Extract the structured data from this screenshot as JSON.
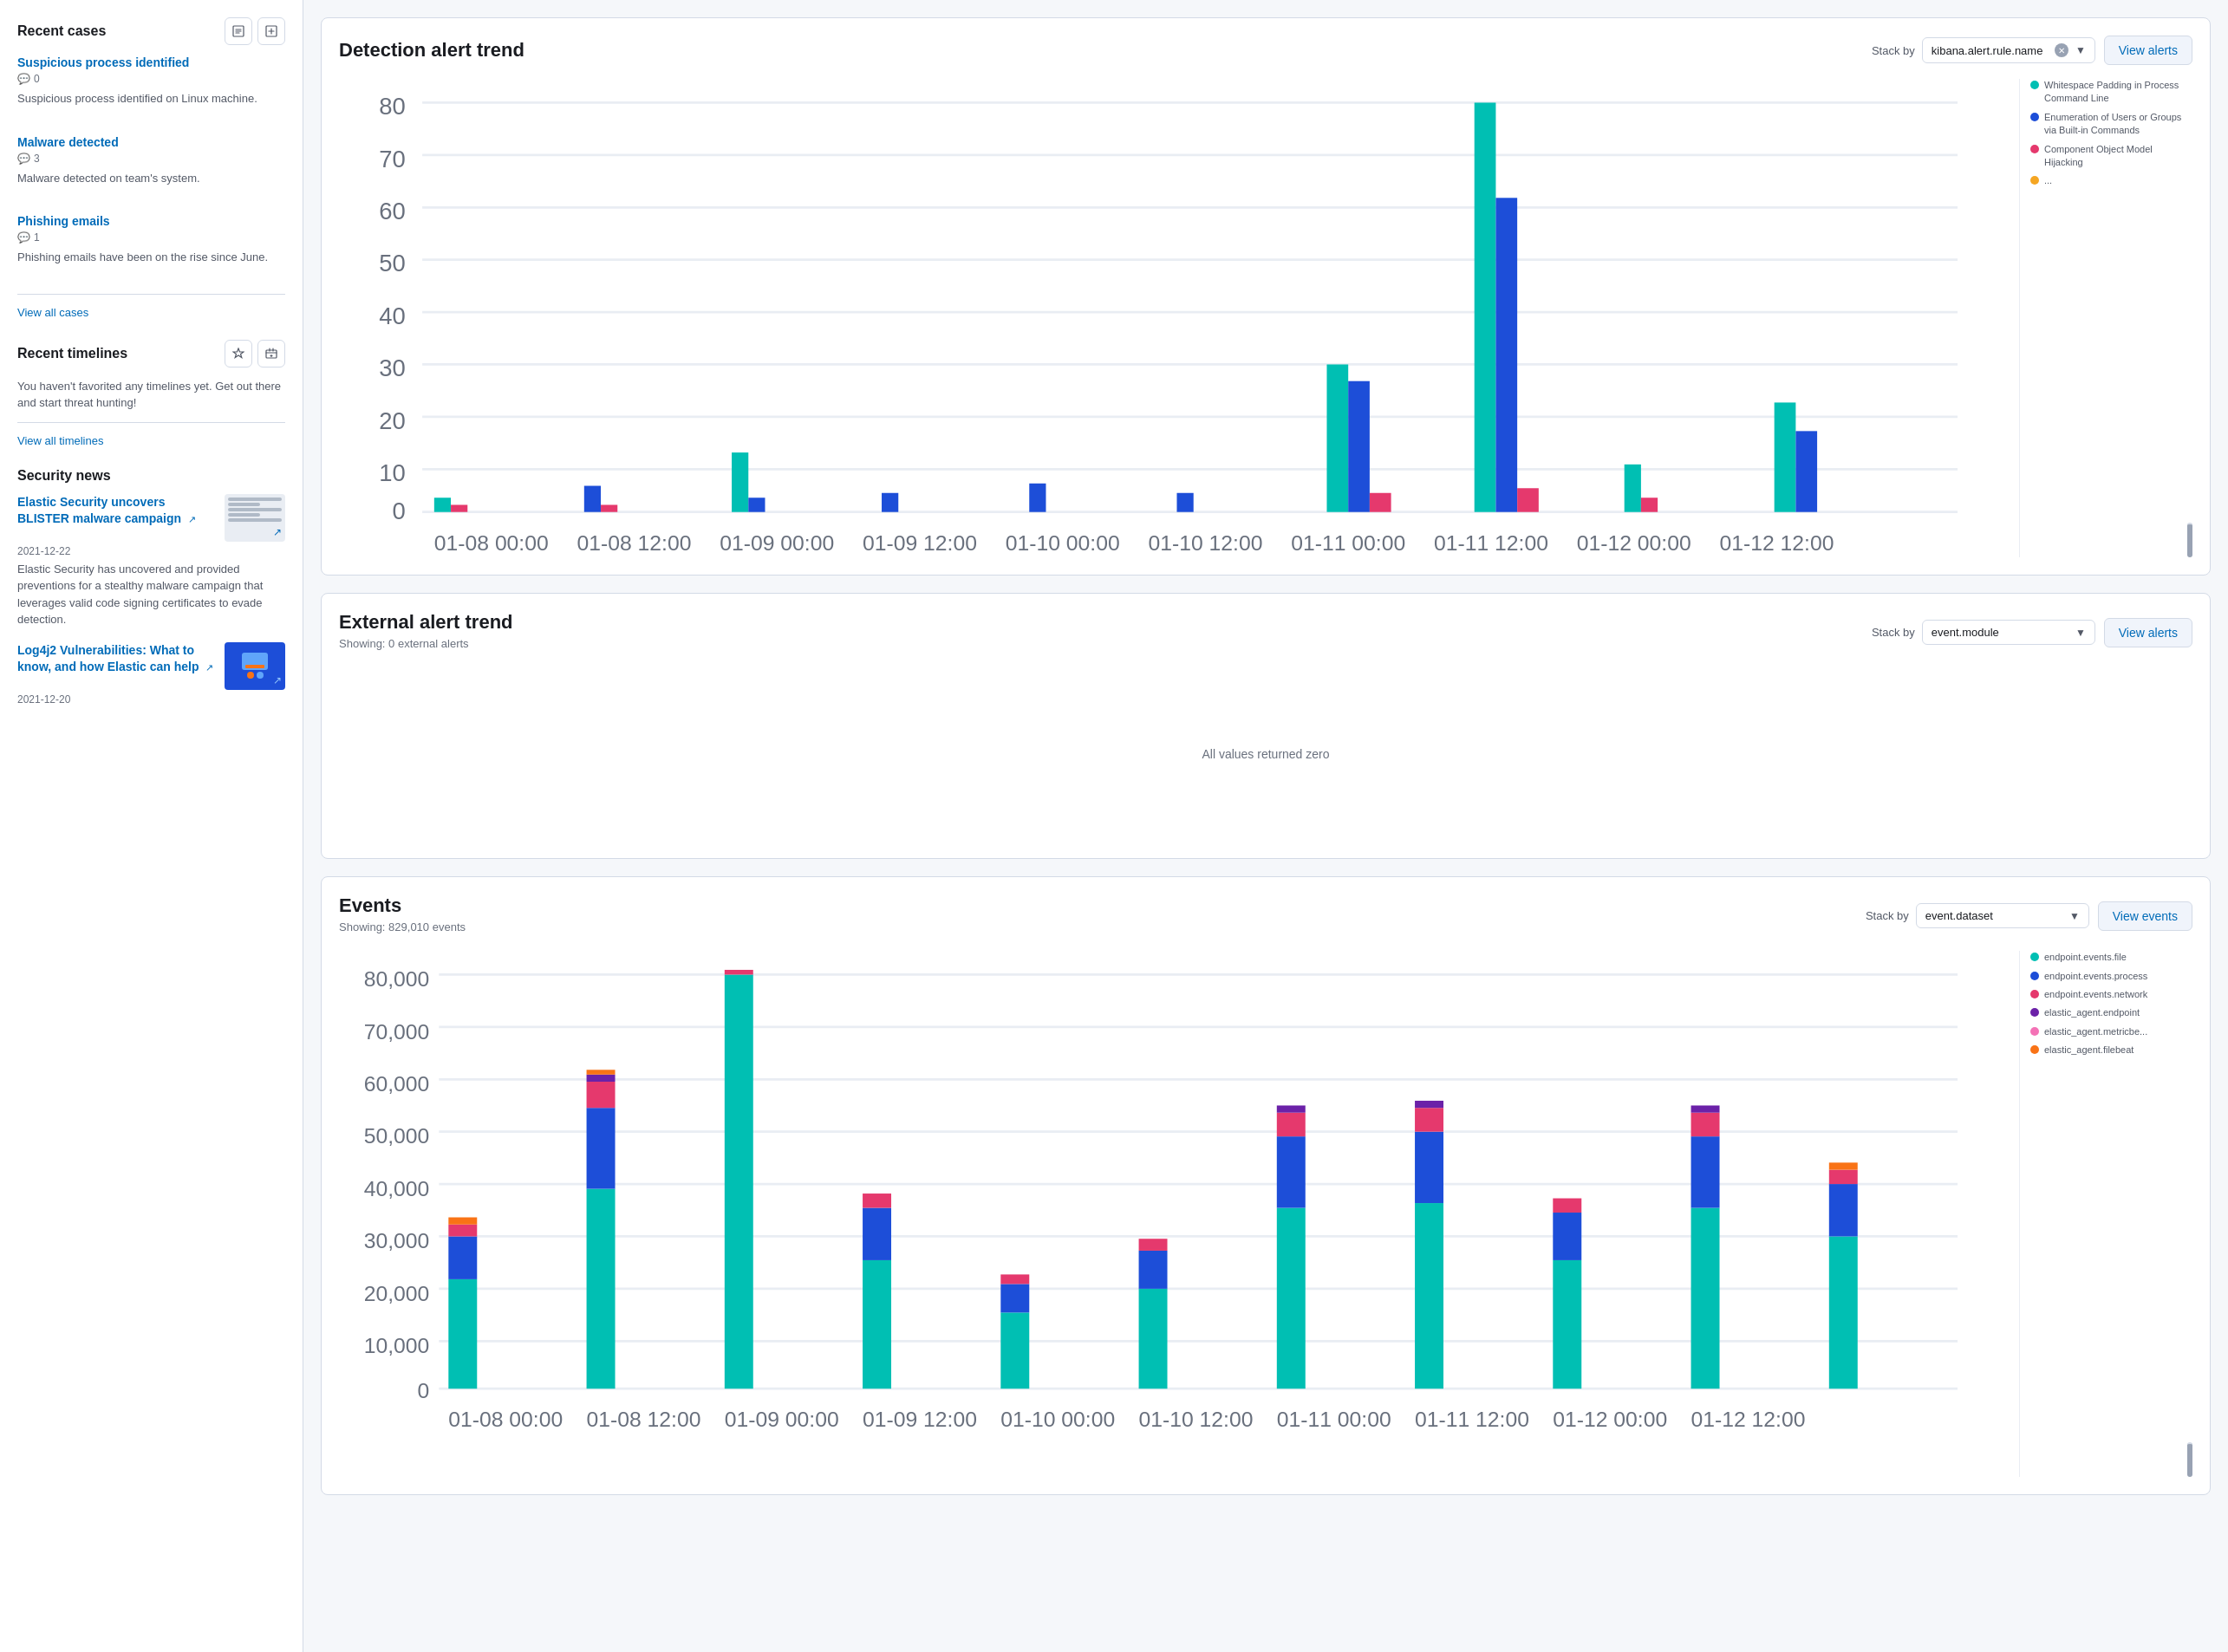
{
  "leftPanel": {
    "recentCases": {
      "title": "Recent cases",
      "cases": [
        {
          "title": "Suspicious process identified",
          "comments": "0",
          "description": "Suspicious process identified on Linux machine."
        },
        {
          "title": "Malware detected",
          "comments": "3",
          "description": "Malware detected on team's system."
        },
        {
          "title": "Phishing emails",
          "comments": "1",
          "description": "Phishing emails have been on the rise since June."
        }
      ],
      "viewAllLabel": "View all cases"
    },
    "recentTimelines": {
      "title": "Recent timelines",
      "message": "You haven't favorited any timelines yet. Get out there and start threat hunting!",
      "viewAllLabel": "View all timelines"
    },
    "securityNews": {
      "title": "Security news",
      "articles": [
        {
          "title": "Elastic Security uncovers BLISTER malware campaign",
          "date": "2021-12-22",
          "description": "Elastic Security has uncovered and provided preventions for a stealthy malware campaign that leverages valid code signing certificates to evade detection."
        },
        {
          "title": "Log4j2 Vulnerabilities: What to know, and how Elastic can help",
          "date": "2021-12-20",
          "description": ""
        }
      ]
    }
  },
  "detectionAlertTrend": {
    "title": "Detection alert trend",
    "stackByLabel": "Stack by",
    "stackByValue": "kibana.alert.rule.name",
    "viewAlertsLabel": "View alerts",
    "legend": [
      {
        "color": "#00bfb3",
        "label": "Whitespace Padding in Process Command Line"
      },
      {
        "color": "#1d4ed8",
        "label": "Enumeration of Users or Groups via Built-in Commands"
      },
      {
        "color": "#e5396d",
        "label": "Component Object Model Hijacking"
      },
      {
        "color": "#f5a623",
        "label": "..."
      }
    ],
    "yAxis": [
      "80",
      "70",
      "60",
      "50",
      "40",
      "30",
      "20",
      "10",
      "0"
    ],
    "xAxis": [
      "01-08 00:00",
      "01-08 12:00",
      "01-09 00:00",
      "01-09 12:00",
      "01-10 00:00",
      "01-10 12:00",
      "01-11 00:00",
      "01-11 12:00",
      "01-12 00:00",
      "01-12 12:00"
    ]
  },
  "externalAlertTrend": {
    "title": "External alert trend",
    "showingLabel": "Showing: 0 external alerts",
    "stackByLabel": "Stack by",
    "stackByValue": "event.module",
    "viewAlertsLabel": "View alerts",
    "zeroState": "All values returned zero"
  },
  "events": {
    "title": "Events",
    "showingLabel": "Showing: 829,010 events",
    "stackByLabel": "Stack by",
    "stackByValue": "event.dataset",
    "viewEventsLabel": "View events",
    "legend": [
      {
        "color": "#00bfb3",
        "label": "endpoint.events.file"
      },
      {
        "color": "#1d4ed8",
        "label": "endpoint.events.process"
      },
      {
        "color": "#e5396d",
        "label": "endpoint.events.network"
      },
      {
        "color": "#6b21a8",
        "label": "elastic_agent.endpoint"
      },
      {
        "color": "#f472b6",
        "label": "elastic_agent.metricbe..."
      },
      {
        "color": "#f97316",
        "label": "elastic_agent.filebeat"
      }
    ],
    "yAxis": [
      "80,000",
      "70,000",
      "60,000",
      "50,000",
      "40,000",
      "30,000",
      "20,000",
      "10,000",
      "0"
    ],
    "xAxis": [
      "01-08 00:00",
      "01-08 12:00",
      "01-09 00:00",
      "01-09 12:00",
      "01-10 00:00",
      "01-10 12:00",
      "01-11 00:00",
      "01-11 12:00",
      "01-12 00:00",
      "01-12 12:00"
    ]
  }
}
